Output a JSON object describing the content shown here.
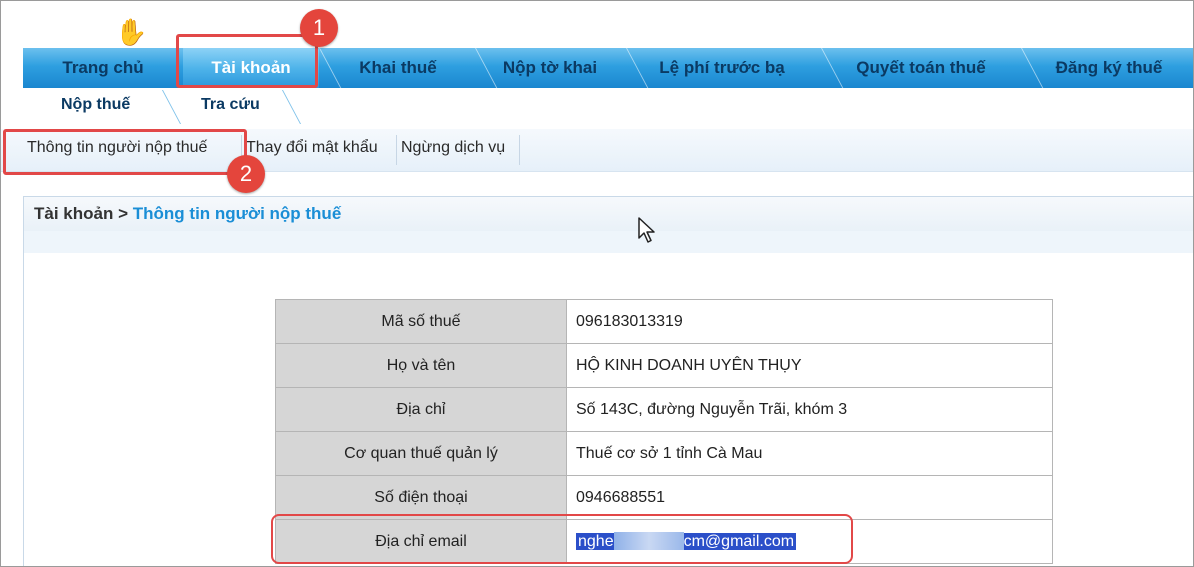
{
  "main_tabs": [
    "Trang chủ",
    "Tài khoản",
    "Khai thuế",
    "Nộp tờ khai",
    "Lệ phí trước bạ",
    "Quyết toán thuế",
    "Đăng ký thuế"
  ],
  "sub_tabs": [
    "Nộp thuế",
    "Tra cứu"
  ],
  "sub_menu": [
    "Thông tin người nộp thuế",
    "Thay đổi mật khẩu",
    "Ngừng dịch vụ"
  ],
  "breadcrumb": {
    "root": "Tài khoản",
    "separator": ">",
    "current": "Thông tin người nộp thuế"
  },
  "info_table": [
    {
      "label": "Mã số thuế",
      "value": "096183013319"
    },
    {
      "label": "Họ và tên",
      "value": "HỘ KINH DOANH UYÊN THỤY"
    },
    {
      "label": "Địa chỉ",
      "value": "Số 143C, đường Nguyễn Trãi, khóm 3"
    },
    {
      "label": "Cơ quan thuế quản lý",
      "value": "Thuế cơ sở 1 tỉnh Cà Mau"
    },
    {
      "label": "Số điện thoại",
      "value": "0946688551"
    }
  ],
  "email_row": {
    "label": "Địa chỉ email",
    "value_start": "nghe",
    "value_end": "cm@gmail.com"
  },
  "annotations": {
    "badge1": "1",
    "badge2": "2"
  },
  "colors": {
    "highlight": "#e24848",
    "badge": "#e4453c",
    "tab_blue": "#2e9fe0",
    "link_blue": "#1a8ed6",
    "selection": "#2b4fc9"
  }
}
